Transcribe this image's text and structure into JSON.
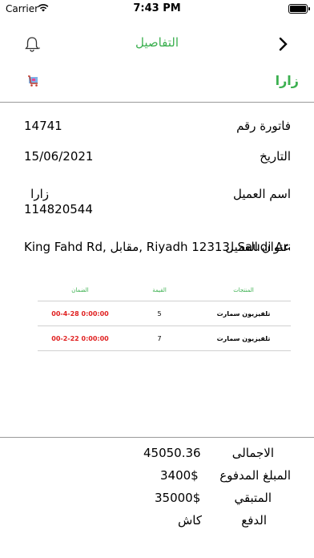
{
  "status_bar": {
    "carrier": "Carrier",
    "time": "7:43 PM"
  },
  "nav": {
    "title": "التفاصيل"
  },
  "store": {
    "name": "زارا"
  },
  "invoice": {
    "number_label": "فاتورة رقم",
    "number_value": "14741",
    "date_label": "التاريخ",
    "date_value": "15/06/2021",
    "customer_label": "اسم العميل",
    "customer_name": "زارا",
    "customer_phone": "114820544",
    "address_label": "عنوان العميل",
    "address_value": "King Fahd Rd, مقابل, Riyadh 12313, Saudi Arabia"
  },
  "table": {
    "headers": {
      "product": "المنتجات",
      "value": "القيمة",
      "warranty": "الضمان"
    },
    "rows": [
      {
        "product": "تلفيزيون سمارت",
        "value": "5",
        "warranty": "00-4-28 0:00:00"
      },
      {
        "product": "تلفيزيون سمارت",
        "value": "7",
        "warranty": "00-2-22 0:00:00"
      }
    ]
  },
  "totals": {
    "total_label": "الاجمالى",
    "total_value": "45050.36",
    "paid_label": "المبلغ المدفوع",
    "paid_value": "3400$",
    "remaining_label": "المتبقي",
    "remaining_value": "35000$",
    "payment_label": "الدفع",
    "payment_value": "كاش"
  },
  "colors": {
    "accent": "#3cb050",
    "warranty": "#e02020",
    "divider": "#9a9a9a"
  },
  "icons": {
    "bell": "bell-icon",
    "back": "chevron-right-icon",
    "cart": "shopping-cart-icon",
    "wifi": "wifi-icon",
    "battery": "battery-icon"
  }
}
